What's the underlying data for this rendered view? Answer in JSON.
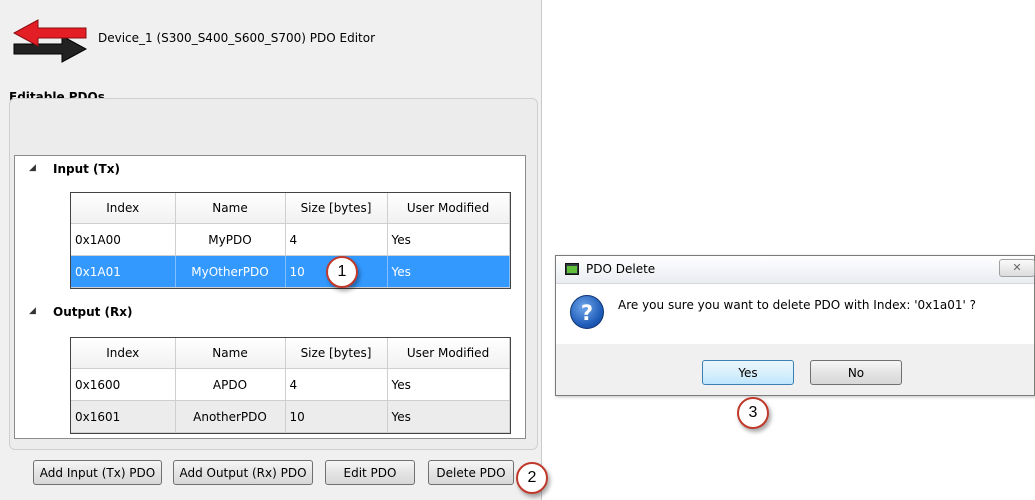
{
  "editor": {
    "title": "Device_1 (S300_S400_S600_S700) PDO Editor",
    "section_title": "Editable PDOs",
    "icon": "red-black-swap-arrows-icon"
  },
  "tree": {
    "input_group": {
      "label": "Input (Tx)",
      "columns": [
        "Index",
        "Name",
        "Size [bytes]",
        "User Modified"
      ],
      "rows": [
        {
          "index": "0x1A00",
          "name": "MyPDO",
          "size": "4",
          "user_modified": "Yes",
          "selected": false
        },
        {
          "index": "0x1A01",
          "name": "MyOtherPDO",
          "size": "10",
          "user_modified": "Yes",
          "selected": true
        }
      ]
    },
    "output_group": {
      "label": "Output (Rx)",
      "columns": [
        "Index",
        "Name",
        "Size [bytes]",
        "User Modified"
      ],
      "rows": [
        {
          "index": "0x1600",
          "name": "APDO",
          "size": "4",
          "user_modified": "Yes"
        },
        {
          "index": "0x1601",
          "name": "AnotherPDO",
          "size": "10",
          "user_modified": "Yes"
        }
      ]
    }
  },
  "buttons": {
    "add_input": "Add Input (Tx) PDO",
    "add_output": "Add Output (Rx) PDO",
    "edit": "Edit PDO",
    "delete": "Delete PDO"
  },
  "callouts": {
    "one": "1",
    "two": "2",
    "three": "3"
  },
  "dialog": {
    "title": "PDO Delete",
    "message": "Are you sure you want to delete PDO with Index: '0x1a01' ?",
    "yes_label": "Yes",
    "no_label": "No",
    "close_glyph": "✕"
  },
  "colors": {
    "selection": "#3399ff",
    "callout_border": "#c0392b",
    "alt_row": "#ececec"
  }
}
